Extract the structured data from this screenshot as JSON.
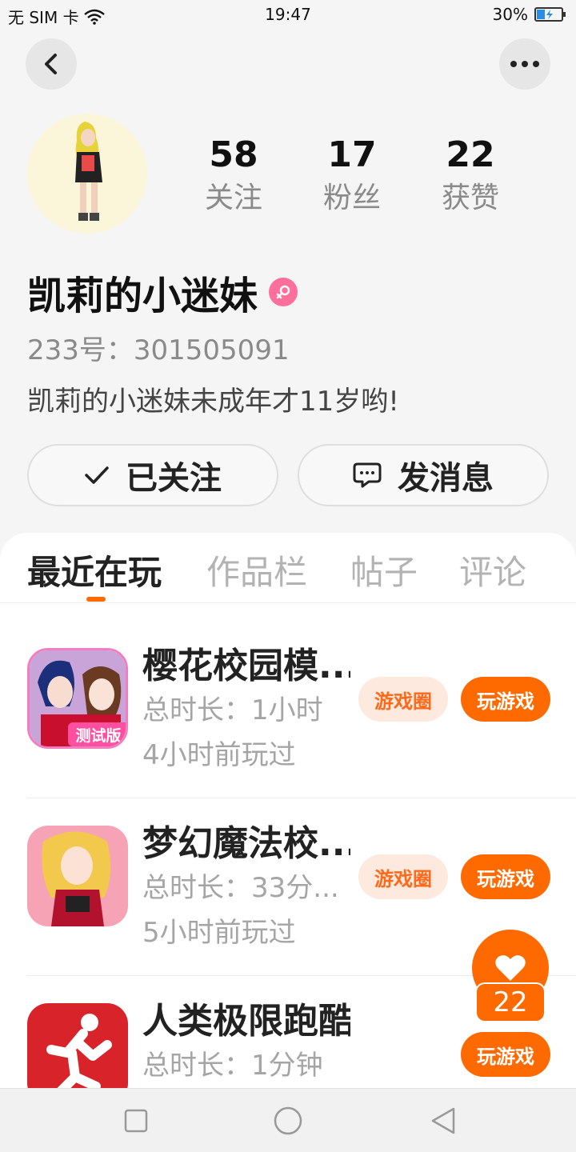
{
  "status_bar": {
    "carrier": "无 SIM 卡",
    "time": "19:47",
    "battery": "30%"
  },
  "profile": {
    "name": "凯莉的小迷妹",
    "uid": "233号：301505091",
    "bio": "凯莉的小迷妹未成年才11岁哟!",
    "gender_icon": "female-icon"
  },
  "stats": [
    {
      "value": "58",
      "label": "关注"
    },
    {
      "value": "17",
      "label": "粉丝"
    },
    {
      "value": "22",
      "label": "获赞"
    }
  ],
  "actions": {
    "followed": "已关注",
    "message": "发消息"
  },
  "tabs": [
    "最近在玩",
    "作品栏",
    "帖子",
    "评论"
  ],
  "games": [
    {
      "title": "樱花校园模...",
      "duration": "总时长：1小时",
      "last_played": "4小时前玩过",
      "circle_label": "游戏圈",
      "play_label": "玩游戏"
    },
    {
      "title": "梦幻魔法校...",
      "duration": "总时长：33分...",
      "last_played": "5小时前玩过",
      "circle_label": "游戏圈",
      "play_label": "玩游戏"
    },
    {
      "title": "人类极限跑酷",
      "duration": "总时长：1分钟",
      "play_label": "玩游戏"
    }
  ],
  "badges": {
    "test_version": "测试版"
  },
  "like_fab": {
    "count": "22"
  },
  "colors": {
    "accent": "#ff6a00",
    "pill_bg": "#fde9de",
    "gender": "#ff6f9b"
  }
}
